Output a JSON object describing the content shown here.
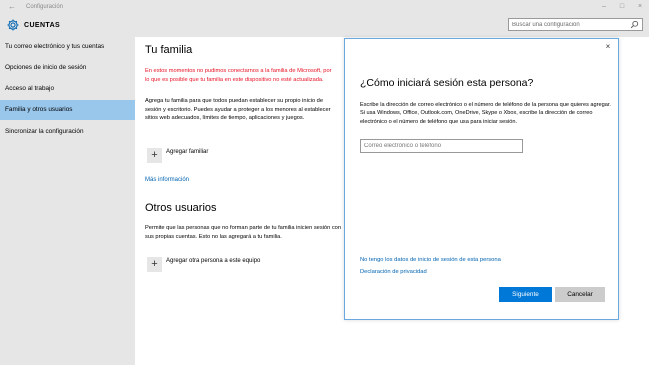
{
  "window": {
    "back_glyph": "←",
    "title": "Configuración",
    "controls": {
      "minimize": "–",
      "maximize": "□",
      "close": "×"
    }
  },
  "header": {
    "section_title": "CUENTAS",
    "search_placeholder": "Buscar una configuración",
    "icons": {
      "section": "gear-icon",
      "search": "search-icon"
    }
  },
  "sidebar": {
    "items": [
      {
        "label": "Tu correo electrónico y tus cuentas",
        "active": false
      },
      {
        "label": "Opciones de inicio de sesión",
        "active": false
      },
      {
        "label": "Acceso al trabajo",
        "active": false
      },
      {
        "label": "Familia y otros usuarios",
        "active": true
      },
      {
        "label": "Sincronizar la configuración",
        "active": false
      }
    ]
  },
  "main": {
    "family_heading": "Tu familia",
    "error_text": "En estos momentos no pudimos conectarnos a la familia de Microsoft, por lo que es posible que tu familia en este dispositivo no esté actualizada.",
    "family_description": "Agrega tu familia para que todos puedan establecer su propio inicio de sesión y escritorio. Puedes ayudar a proteger a los menores al establecer sitios web adecuados, límites de tiempo, aplicaciones y juegos.",
    "add_family_label": "Agregar familiar",
    "more_info_link": "Más información",
    "others_heading": "Otros usuarios",
    "others_description": "Permite que las personas que no forman parte de tu familia inicien sesión con sus propias cuentas. Esto no las agregará a tu familia.",
    "add_other_label": "Agregar otra persona a este equipo",
    "add_glyph": "+"
  },
  "dialog": {
    "close_glyph": "×",
    "title": "¿Cómo iniciará sesión esta persona?",
    "description": "Escribe la dirección de correo electrónico o el número de teléfono de la persona que quieres agregar. Si usa Windows, Office, Outlook.com, OneDrive, Skype o Xbox, escribe la dirección de correo electrónico o el número de teléfono que usa para iniciar sesión.",
    "input_placeholder": "Correo electrónico o teléfono",
    "no_data_link": "No tengo los datos de inicio de sesión de esta persona",
    "privacy_link": "Declaración de privacidad",
    "next_button": "Siguiente",
    "cancel_button": "Cancelar"
  },
  "colors": {
    "accent": "#0078d7",
    "link": "#0063b1",
    "error": "#e81123",
    "sidebar_bg": "#e6e6e6",
    "sidebar_active": "#99c6eb"
  }
}
